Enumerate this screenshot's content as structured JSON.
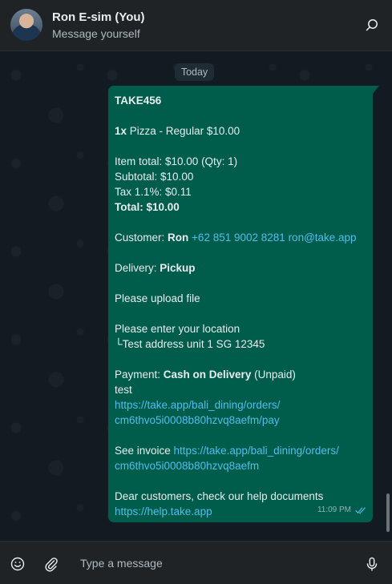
{
  "header": {
    "contact_name": "Ron E-sim (You)",
    "contact_subtitle": "Message yourself",
    "search_icon": "search-icon",
    "avatar": "profile-photo"
  },
  "chat": {
    "date_divider": "Today",
    "message": {
      "order_code": "TAKE456",
      "item_qty": "1x",
      "item_desc": " Pizza - Regular $10.00",
      "item_total": "Item total: $10.00 (Qty: 1)",
      "subtotal": "Subtotal: $10.00",
      "tax": "Tax 1.1%: $0.11",
      "total": "Total: $10.00",
      "customer_label": "Customer: ",
      "customer_name": "Ron",
      "customer_phone": "+62 851 9002 8281",
      "customer_email": "ron@take.app",
      "delivery_label": "Delivery: ",
      "delivery_value": "Pickup",
      "upload_note": "Please upload file",
      "location_prompt": "Please enter your location",
      "location_value": "└Test address unit 1 SG 12345",
      "payment_label": "Payment: ",
      "payment_method": "Cash on Delivery",
      "payment_status": " (Unpaid)",
      "note": "test",
      "pay_link_1": "https://take.app/bali_dining/orders/",
      "pay_link_2": "cm6thvo5i0008b80hzvq8aefm/pay",
      "invoice_label": "See invoice ",
      "invoice_link_1": "https://take.app/bali_dining/orders/",
      "invoice_link_2": "cm6thvo5i0008b80hzvq8aefm",
      "help_text": "Dear customers, check our help documents",
      "help_link": "https://help.take.app",
      "time": "11:09 PM",
      "status_icon": "double-check-read-icon"
    }
  },
  "footer": {
    "input_placeholder": "Type a message",
    "emoji_icon": "emoji-icon",
    "attach_icon": "paperclip-icon",
    "mic_icon": "microphone-icon"
  },
  "colors": {
    "header_bg": "#1f2326",
    "chat_bg": "#111b21",
    "outgoing_bubble": "#005c4b",
    "link": "#53bdeb",
    "read_ticks": "#53bdeb"
  }
}
